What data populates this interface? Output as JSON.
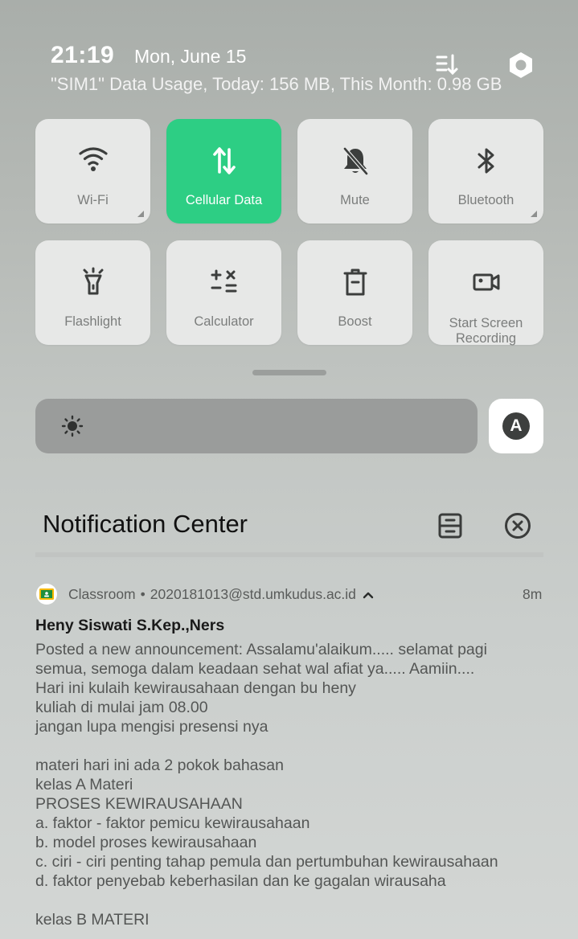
{
  "status": {
    "time": "21:19",
    "date": "Mon, June 15",
    "data_usage": "\"SIM1\" Data Usage, Today: 156 MB, This Month: 0.98 GB"
  },
  "header_icons": {
    "edit": "edit-list-icon",
    "settings": "settings-gear-icon"
  },
  "tiles": [
    {
      "label": "Wi-Fi",
      "icon": "wifi-icon",
      "active": false
    },
    {
      "label": "Cellular Data",
      "icon": "cellular-data-icon",
      "active": true
    },
    {
      "label": "Mute",
      "icon": "mute-bell-icon",
      "active": false
    },
    {
      "label": "Bluetooth",
      "icon": "bluetooth-icon",
      "active": false
    },
    {
      "label": "Flashlight",
      "icon": "flashlight-icon",
      "active": false
    },
    {
      "label": "Calculator",
      "icon": "calculator-icon",
      "active": false
    },
    {
      "label": "Boost",
      "icon": "boost-trash-icon",
      "active": false
    },
    {
      "label": "Start Screen Recording",
      "icon": "screen-record-icon",
      "active": false
    }
  ],
  "brightness": {
    "icon": "sun-icon",
    "auto_label": "A"
  },
  "notification_center": {
    "title": "Notification Center",
    "manage_icon": "manage-notifications-icon",
    "clear_icon": "clear-all-icon"
  },
  "notification": {
    "app": "Classroom",
    "separator": "•",
    "account": "2020181013@std.umkudus.ac.id",
    "time": "8m",
    "sender": "Heny Siswati S.Kep.,Ners",
    "body": "Posted a new announcement: Assalamu'alaikum..... selamat pagi\nsemua, semoga dalam keadaan sehat wal afiat ya..... Aamiin....\nHari ini kulaih kewirausahaan dengan bu heny\nkuliah di mulai jam 08.00\njangan lupa mengisi presensi nya\n\nmateri hari ini ada 2 pokok bahasan\nkelas A Materi\nPROSES KEWIRAUSAHAAN\na. faktor - faktor pemicu kewirausahaan\nb. model proses kewirausahaan\nc. ciri - ciri penting tahap pemula dan pertumbuhan kewirausahaan\nd. faktor penyebab keberhasilan dan ke gagalan wirausaha\n\nkelas B MATERI"
  },
  "colors": {
    "accent": "#2dce84",
    "tile_bg": "#e7e8e7"
  }
}
